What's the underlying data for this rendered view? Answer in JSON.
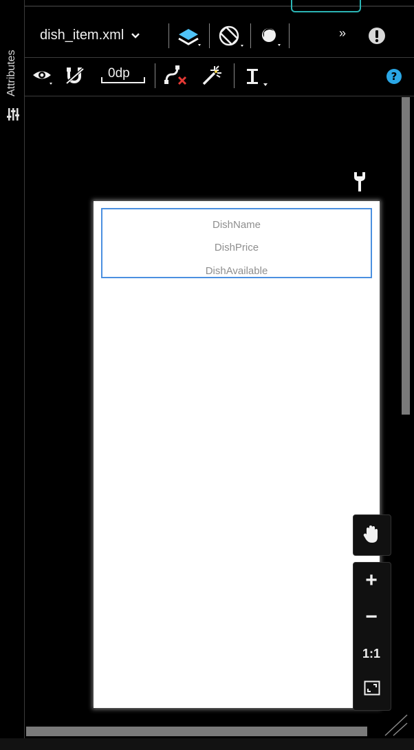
{
  "side_panel": {
    "label": "Attributes",
    "icon": "attributes-icon"
  },
  "toolbar_top": {
    "file_name": "dish_item.xml",
    "icons": [
      "layers-icon",
      "orientation-icon",
      "theme-icon",
      "overflow-icon",
      "warning-icon"
    ],
    "accent_color": "#4fc3f7"
  },
  "toolbar_second": {
    "margin_value": "0dp",
    "icons": [
      "view-options-icon",
      "autoconnect-icon",
      "clear-constraints-icon",
      "infer-constraints-icon",
      "guidelines-icon",
      "help-icon"
    ],
    "help_color": "#2aa7e6"
  },
  "canvas": {
    "items": [
      "DishName",
      "DishPrice",
      "DishAvailable"
    ],
    "selection_color": "#4a8fe0",
    "wrench_icon": "wrench-icon"
  },
  "zoom_controls": {
    "pan_icon": "hand-icon",
    "zoom_in": "+",
    "zoom_out": "−",
    "actual_size": "1:1",
    "fit_icon": "fit-screen-icon"
  }
}
